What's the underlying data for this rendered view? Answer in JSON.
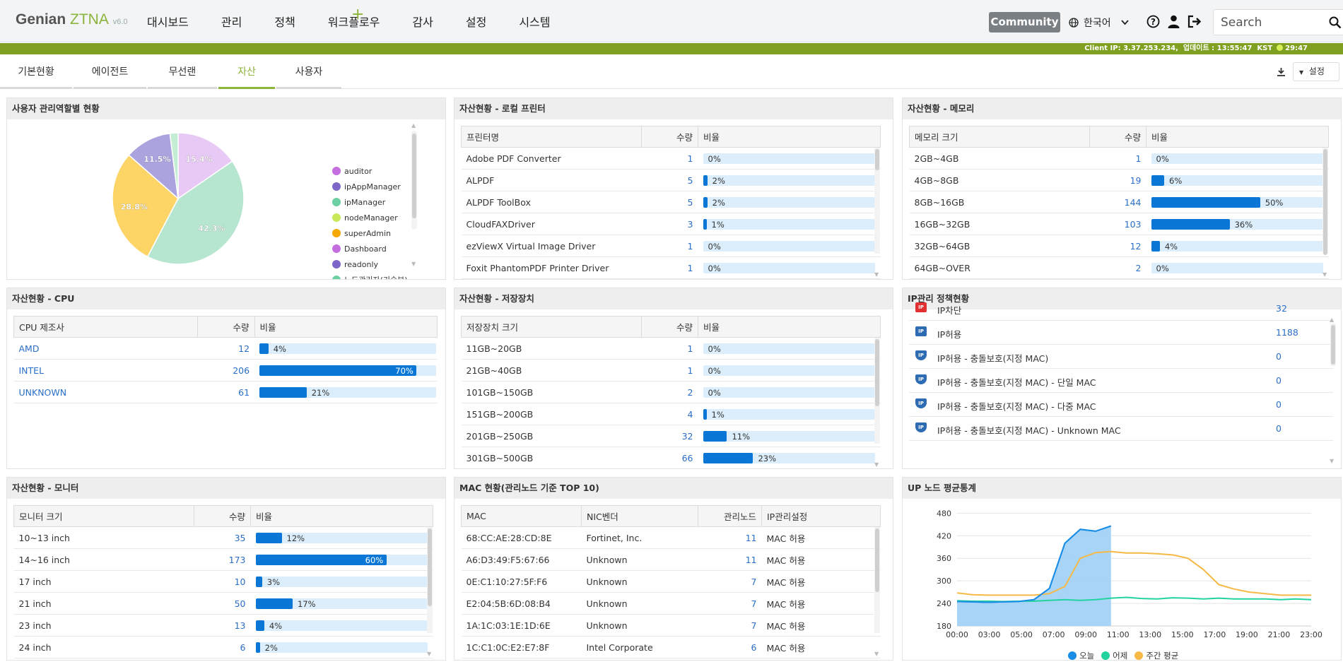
{
  "brand": {
    "name": "Genian",
    "product": "ZTNA",
    "version": "v6.0"
  },
  "menu": [
    "대시보드",
    "관리",
    "정책",
    "워크플로우",
    "감사",
    "설정",
    "시스템"
  ],
  "topbar": {
    "community": "Community",
    "language": "한국어",
    "search_placeholder": "Search"
  },
  "statusbar": {
    "client_ip_label": "Client IP:",
    "client_ip": "3.37.253.234,",
    "update_label": "업데이트 :",
    "update_time": "13:55:47",
    "tz": "KST",
    "session": "29:47"
  },
  "tabs": [
    "기본현황",
    "에이전트",
    "무선랜",
    "자산",
    "사용자"
  ],
  "tab_active": 3,
  "tab_settings": "설정",
  "panels": {
    "roles": {
      "title": "사용자 관리역할별 현황"
    },
    "printer": {
      "title": "자산현황 - 로컬 프린터",
      "headers": [
        "프린터명",
        "수량",
        "비율"
      ],
      "rows": [
        {
          "name": "Adobe PDF Converter",
          "count": "1",
          "pct": 0,
          "label": "0%"
        },
        {
          "name": "ALPDF",
          "count": "5",
          "pct": 2,
          "label": "2%"
        },
        {
          "name": "ALPDF ToolBox",
          "count": "5",
          "pct": 2,
          "label": "2%"
        },
        {
          "name": "CloudFAXDriver",
          "count": "3",
          "pct": 1,
          "label": "1%"
        },
        {
          "name": "ezViewX Virtual Image Driver",
          "count": "1",
          "pct": 0,
          "label": "0%"
        },
        {
          "name": "Foxit PhantomPDF Printer Driver",
          "count": "1",
          "pct": 0,
          "label": "0%"
        }
      ]
    },
    "memory": {
      "title": "자산현황 - 메모리",
      "headers": [
        "메모리 크기",
        "수량",
        "비율"
      ],
      "rows": [
        {
          "name": "2GB~4GB",
          "count": "1",
          "pct": 0,
          "label": "0%"
        },
        {
          "name": "4GB~8GB",
          "count": "19",
          "pct": 6,
          "label": "6%"
        },
        {
          "name": "8GB~16GB",
          "count": "144",
          "pct": 50,
          "label": "50%"
        },
        {
          "name": "16GB~32GB",
          "count": "103",
          "pct": 36,
          "label": "36%"
        },
        {
          "name": "32GB~64GB",
          "count": "12",
          "pct": 4,
          "label": "4%"
        },
        {
          "name": "64GB~OVER",
          "count": "2",
          "pct": 0,
          "label": "0%"
        }
      ]
    },
    "cpu": {
      "title": "자산현황 - CPU",
      "headers": [
        "CPU 제조사",
        "수량",
        "비율"
      ],
      "rows": [
        {
          "name": "AMD",
          "count": "12",
          "pct": 4,
          "label": "4%"
        },
        {
          "name": "INTEL",
          "count": "206",
          "pct": 70,
          "label": "70%"
        },
        {
          "name": "UNKNOWN",
          "count": "61",
          "pct": 21,
          "label": "21%"
        }
      ]
    },
    "storage": {
      "title": "자산현황 - 저장장치",
      "headers": [
        "저장장치 크기",
        "수량",
        "비율"
      ],
      "rows": [
        {
          "name": "11GB~20GB",
          "count": "1",
          "pct": 0,
          "label": "0%"
        },
        {
          "name": "21GB~40GB",
          "count": "1",
          "pct": 0,
          "label": "0%"
        },
        {
          "name": "101GB~150GB",
          "count": "2",
          "pct": 0,
          "label": "0%"
        },
        {
          "name": "151GB~200GB",
          "count": "4",
          "pct": 1,
          "label": "1%"
        },
        {
          "name": "201GB~250GB",
          "count": "32",
          "pct": 11,
          "label": "11%"
        },
        {
          "name": "301GB~500GB",
          "count": "66",
          "pct": 23,
          "label": "23%"
        }
      ]
    },
    "ippolicy": {
      "title": "IP관리 정책현황",
      "rows": [
        {
          "label": "IP차단",
          "value": "32",
          "icon_color": "#e03030",
          "icon": "ip-block-icon"
        },
        {
          "label": "IP허용",
          "value": "1188",
          "icon_color": "#2d6bb3",
          "icon": "ip-allow-icon"
        },
        {
          "label": "IP허용 - 충돌보호(지정 MAC)",
          "value": "0",
          "icon_color": "#2d6bb3",
          "icon": "ip-protect-icon"
        },
        {
          "label": "IP허용 - 충돌보호(지정 MAC) - 단일 MAC",
          "value": "0",
          "icon_color": "#2d6bb3",
          "icon": "ip-protect-single-icon"
        },
        {
          "label": "IP허용 - 충돌보호(지정 MAC) - 다중 MAC",
          "value": "0",
          "icon_color": "#2d6bb3",
          "icon": "ip-protect-multi-icon"
        },
        {
          "label": "IP허용 - 충돌보호(지정 MAC) - Unknown MAC",
          "value": "0",
          "icon_color": "#2d6bb3",
          "icon": "ip-protect-unknown-icon"
        }
      ]
    },
    "monitor": {
      "title": "자산현황 - 모니터",
      "headers": [
        "모니터 크기",
        "수량",
        "비율"
      ],
      "rows": [
        {
          "name": "10~13 inch",
          "count": "35",
          "pct": 12,
          "label": "12%"
        },
        {
          "name": "14~16 inch",
          "count": "173",
          "pct": 60,
          "label": "60%"
        },
        {
          "name": "17 inch",
          "count": "10",
          "pct": 3,
          "label": "3%"
        },
        {
          "name": "21 inch",
          "count": "50",
          "pct": 17,
          "label": "17%"
        },
        {
          "name": "23 inch",
          "count": "13",
          "pct": 4,
          "label": "4%"
        },
        {
          "name": "24 inch",
          "count": "6",
          "pct": 2,
          "label": "2%"
        }
      ]
    },
    "mac": {
      "title": "MAC 현황(관리노드 기준 TOP 10)",
      "headers": [
        "MAC",
        "NIC벤더",
        "관리노드",
        "IP관리설정"
      ],
      "rows": [
        {
          "mac": "68:CC:AE:28:CD:8E",
          "vendor": "Fortinet, Inc.",
          "nodes": "11",
          "ip": "MAC 허용"
        },
        {
          "mac": "A6:D3:49:F5:67:66",
          "vendor": "Unknown",
          "nodes": "11",
          "ip": "MAC 허용"
        },
        {
          "mac": "0E:C1:10:27:5F:F6",
          "vendor": "Unknown",
          "nodes": "7",
          "ip": "MAC 허용"
        },
        {
          "mac": "E2:04:5B:6D:08:B4",
          "vendor": "Unknown",
          "nodes": "7",
          "ip": "MAC 허용"
        },
        {
          "mac": "1A:1C:03:1E:1D:6E",
          "vendor": "Unknown",
          "nodes": "7",
          "ip": "MAC 허용"
        },
        {
          "mac": "1C:C1:0C:E2:E7:8F",
          "vendor": "Intel Corporate",
          "nodes": "6",
          "ip": "MAC 허용"
        }
      ]
    },
    "upnode": {
      "title": "UP 노드 평균통계"
    }
  },
  "chart_data": [
    {
      "type": "pie",
      "labels": [
        "auditor",
        "ipAppManager",
        "ipManager",
        "nodeManager",
        "superAdmin",
        "Dashboard",
        "readonly",
        "노드관리자(기술부)"
      ],
      "colors": [
        "#c46ee0",
        "#7e66c8",
        "#6cd0a2",
        "#c9e95b",
        "#f5a800",
        "#c46ee0",
        "#7e66c8",
        "#6cd0a2"
      ],
      "slices": [
        {
          "label": "15.4%",
          "value": 15.4,
          "color": "#e8c8f4"
        },
        {
          "label": "42.3%",
          "value": 42.3,
          "color": "#b6e6d0"
        },
        {
          "label": "28.8%",
          "value": 28.8,
          "color": "#fdd466"
        },
        {
          "label": "11.5%",
          "value": 11.5,
          "color": "#aba3de"
        },
        {
          "label": "",
          "value": 2.0,
          "color": "#c4edd4"
        }
      ]
    },
    {
      "type": "line",
      "x": [
        "00:00",
        "03:00",
        "05:00",
        "07:00",
        "09:00",
        "11:00",
        "13:00",
        "15:00",
        "17:00",
        "19:00",
        "21:00",
        "23:00"
      ],
      "yticks": [
        180,
        240,
        300,
        360,
        420,
        480
      ],
      "ylim": [
        180,
        490
      ],
      "series": [
        {
          "name": "오늘",
          "color": "#1a8ee6",
          "values": [
            245,
            244,
            243,
            244,
            245,
            250,
            280,
            400,
            437,
            432,
            446,
            null,
            null,
            null,
            null,
            null,
            null,
            null,
            null,
            null,
            null,
            null,
            null,
            null
          ]
        },
        {
          "name": "어제",
          "color": "#22d3a0",
          "values": [
            247,
            246,
            246,
            245,
            246,
            246,
            248,
            250,
            248,
            250,
            254,
            256,
            253,
            252,
            255,
            254,
            252,
            254,
            252,
            252,
            252,
            250,
            252,
            250
          ]
        },
        {
          "name": "주간 평균",
          "color": "#f7b946",
          "values": [
            268,
            263,
            262,
            262,
            262,
            262,
            266,
            285,
            360,
            375,
            378,
            374,
            374,
            372,
            369,
            360,
            330,
            290,
            278,
            270,
            266,
            262,
            262,
            262
          ]
        }
      ]
    }
  ]
}
